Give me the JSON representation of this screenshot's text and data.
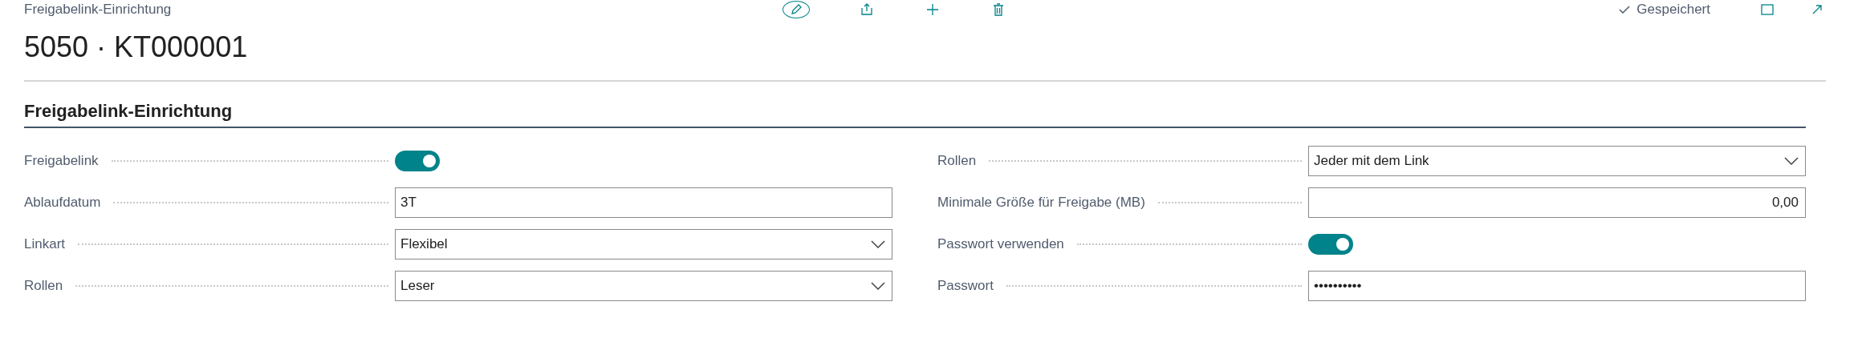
{
  "breadcrumb": "Freigabelink-Einrichtung",
  "save_status": "Gespeichert",
  "title": "5050 · KT000001",
  "section": {
    "title": "Freigabelink-Einrichtung",
    "columns": [
      [
        {
          "label": "Freigabelink",
          "kind": "toggle",
          "on": true
        },
        {
          "label": "Ablaufdatum",
          "kind": "text",
          "value": "3T"
        },
        {
          "label": "Linkart",
          "kind": "select",
          "value": "Flexibel"
        },
        {
          "label": "Rollen",
          "kind": "select",
          "value": "Leser"
        }
      ],
      [
        {
          "label": "Rollen",
          "kind": "select",
          "value": "Jeder mit dem Link"
        },
        {
          "label": "Minimale Größe für Freigabe (MB)",
          "kind": "number",
          "value": "0,00"
        },
        {
          "label": "Passwort verwenden",
          "kind": "toggle",
          "on": true
        },
        {
          "label": "Passwort",
          "kind": "password",
          "value": "••••••••••"
        }
      ]
    ]
  }
}
